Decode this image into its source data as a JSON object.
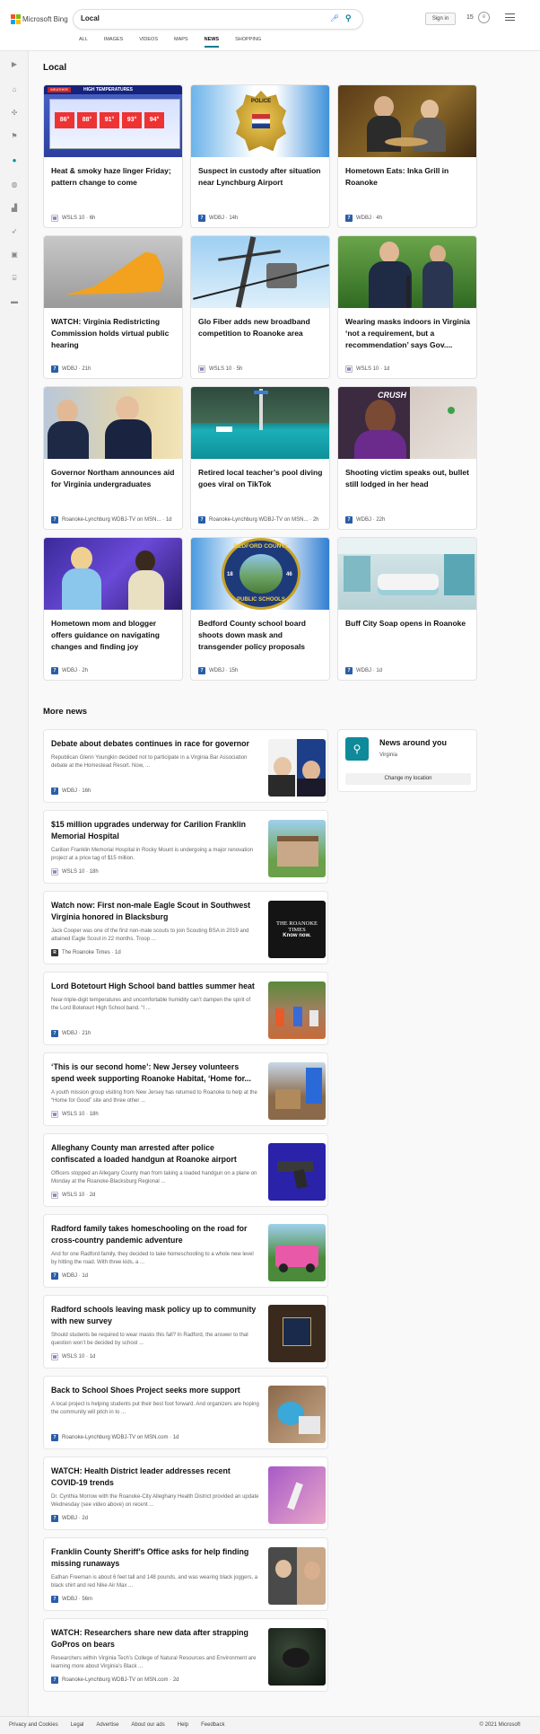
{
  "header": {
    "logo_text": "Microsoft Bing",
    "search_value": "Local",
    "signin_label": "Sign in",
    "rewards_count": "15",
    "tabs": [
      {
        "label": "ALL"
      },
      {
        "label": "IMAGES"
      },
      {
        "label": "VIDEOS"
      },
      {
        "label": "MAPS"
      },
      {
        "label": "NEWS"
      },
      {
        "label": "SHOPPING"
      }
    ]
  },
  "local": {
    "heading": "Local",
    "cards": [
      {
        "title": "Heat & smoky haze linger Friday; pattern change to come",
        "source": "WSLS 10",
        "time": "6h",
        "image_caption": "HIGH TEMPERATURES",
        "temps": [
          "86°",
          "88°",
          "91°",
          "93°",
          "94°"
        ]
      },
      {
        "title": "Suspect in custody after situation near Lynchburg Airport",
        "source": "WDBJ",
        "time": "14h",
        "badge_text": "POLICE"
      },
      {
        "title": "Hometown Eats: Inka Grill in Roanoke",
        "source": "WDBJ",
        "time": "4h"
      },
      {
        "title": "WATCH: Virginia Redistricting Commission holds virtual public hearing",
        "source": "WDBJ",
        "time": "21h"
      },
      {
        "title": "Glo Fiber adds new broadband competition to Roanoke area",
        "source": "WSLS 10",
        "time": "5h"
      },
      {
        "title": "Wearing masks indoors in Virginia ‘not a requirement, but a recommendation’ says Gov....",
        "source": "WSLS 10",
        "time": "1d"
      },
      {
        "title": "Governor Northam announces aid for Virginia undergraduates",
        "source": "Roanoke-Lynchburg WDBJ-TV on MSN...",
        "time": "1d"
      },
      {
        "title": "Retired local teacher’s pool diving goes viral on TikTok",
        "source": "Roanoke-Lynchburg WDBJ-TV on MSN...",
        "time": "2h"
      },
      {
        "title": "Shooting victim speaks out, bullet still lodged in her head",
        "source": "WDBJ",
        "time": "22h",
        "image_caption": "CRUSH"
      },
      {
        "title": "Hometown mom and blogger offers guidance on navigating changes and finding joy",
        "source": "WDBJ",
        "time": "2h"
      },
      {
        "title": "Bedford County school board shoots down mask and transgender policy proposals",
        "source": "WDBJ",
        "time": "15h",
        "seal_top": "BEDFORD COUNTY",
        "seal_bottom": "PUBLIC SCHOOLS",
        "seal_left": "18",
        "seal_right": "46"
      },
      {
        "title": "Buff City Soap opens in Roanoke",
        "source": "WDBJ",
        "time": "1d"
      }
    ]
  },
  "more": {
    "heading": "More news",
    "items": [
      {
        "title": "Debate about debates continues in race for governor",
        "snippet": "Republican Glenn Youngkin decided not to participate in a Virginia Bar Association debate at the Homestead Resort. Now, ...",
        "source": "WDBJ",
        "time": "16h"
      },
      {
        "title": "$15 million upgrades underway for Carilion Franklin Memorial Hospital",
        "snippet": "Carilion Franklin Memorial Hospital in Rocky Mount is undergoing a major renovation project at a price tag of $15 million.",
        "source": "WSLS 10",
        "time": "18h"
      },
      {
        "title": "Watch now: First non-male Eagle Scout in Southwest Virginia honored in Blacksburg",
        "snippet": "Jack Cooper was one of the first non-male scouts to join Scouting BSA in 2019 and attained Eagle Scout in 22 months. Troop ...",
        "source": "The Roanoke Times",
        "time": "1d",
        "thumb_text": "THE ROANOKE TIMES",
        "thumb_sub": "Know now."
      },
      {
        "title": "Lord Botetourt High School band battles summer heat",
        "snippet": "Near-triple-digit temperatures and uncomfortable humidity can’t dampen the spirit of the Lord Botetourt High School band. “I ...",
        "source": "WDBJ",
        "time": "21h"
      },
      {
        "title": "‘This is our second home’: New Jersey volunteers spend week supporting Roanoke Habitat, ‘Home for...",
        "snippet": "A youth mission group visiting from New Jersey has returned to Roanoke to help at the “Home for Good” site and three other ...",
        "source": "WSLS 10",
        "time": "18h"
      },
      {
        "title": "Alleghany County man arrested after police confiscated a loaded handgun at Roanoke airport",
        "snippet": "Officers stopped an Allegany County man from taking a loaded handgun on a plane on Monday at the Roanoke-Blacksburg Regional ...",
        "source": "WSLS 10",
        "time": "2d"
      },
      {
        "title": "Radford family takes homeschooling on the road for cross-country pandemic adventure",
        "snippet": "And for one Radford family, they decided to take homeschooling to a whole new level by hitting the road. With three kids, a ...",
        "source": "WDBJ",
        "time": "1d"
      },
      {
        "title": "Radford schools leaving mask policy up to community with new survey",
        "snippet": "Should students be required to wear masks this fall? In Radford, the answer to that question won’t be decided by school ...",
        "source": "WSLS 10",
        "time": "1d"
      },
      {
        "title": "Back to School Shoes Project seeks more support",
        "snippet": "A local project is helping students put their best foot forward. And organizers are hoping the community will pitch in to ...",
        "source": "Roanoke-Lynchburg WDBJ-TV on MSN.com",
        "time": "1d"
      },
      {
        "title": "WATCH: Health District leader addresses recent COVID-19 trends",
        "snippet": "Dr. Cynthia Morrow with the Roanoke-City Alleghany Health District provided an update Wednesday (see video above) on recent ...",
        "source": "WDBJ",
        "time": "2d"
      },
      {
        "title": "Franklin County Sheriff’s Office asks for help finding missing runaways",
        "snippet": "Eathan Freeman is about 6 feet tall and 148 pounds, and was wearing black joggers, a black shirt and red Nike Air Max ...",
        "source": "WDBJ",
        "time": "56m"
      },
      {
        "title": "WATCH: Researchers share new data after strapping GoPros on bears",
        "snippet": "Researchers within Virginia Tech’s College of Natural Resources and Environment are learning more about Virginia’s Black ...",
        "source": "Roanoke-Lynchburg WDBJ-TV on MSN.com",
        "time": "2d"
      }
    ]
  },
  "news_around": {
    "title": "News around you",
    "location": "Virginia",
    "button_label": "Change my location"
  },
  "footer": {
    "links": [
      "Privacy and Cookies",
      "Legal",
      "Advertise",
      "About our ads",
      "Help",
      "Feedback"
    ],
    "copyright": "© 2021 Microsoft"
  }
}
